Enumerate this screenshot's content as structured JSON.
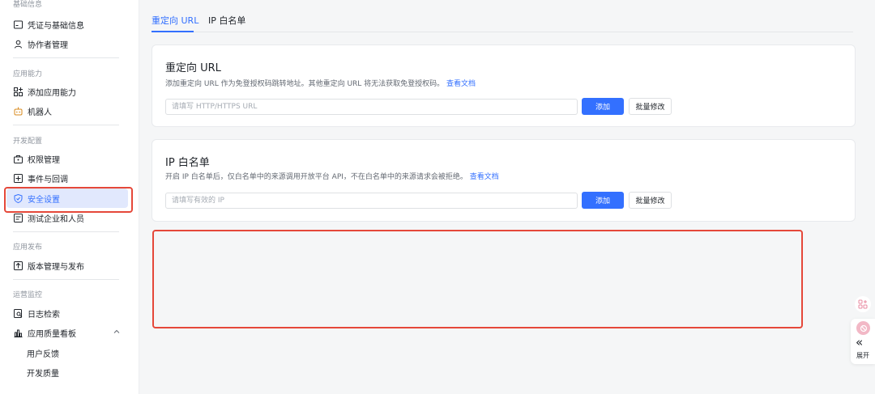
{
  "sidebar": {
    "groups": [
      {
        "title": "基础信息",
        "items": [
          {
            "label": "凭证与基础信息",
            "icon": "credential-icon"
          },
          {
            "label": "协作者管理",
            "icon": "user-icon"
          }
        ]
      },
      {
        "title": "应用能力",
        "items": [
          {
            "label": "添加应用能力",
            "icon": "apps-add-icon"
          },
          {
            "label": "机器人",
            "icon": "robot-icon"
          }
        ]
      },
      {
        "title": "开发配置",
        "items": [
          {
            "label": "权限管理",
            "icon": "permission-icon"
          },
          {
            "label": "事件与回调",
            "icon": "event-icon"
          },
          {
            "label": "安全设置",
            "icon": "shield-icon",
            "active": true
          },
          {
            "label": "测试企业和人员",
            "icon": "test-org-icon"
          }
        ]
      },
      {
        "title": "应用发布",
        "items": [
          {
            "label": "版本管理与发布",
            "icon": "upload-icon"
          }
        ]
      },
      {
        "title": "运营监控",
        "items": [
          {
            "label": "日志检索",
            "icon": "log-search-icon"
          },
          {
            "label": "应用质量看板",
            "icon": "bar-chart-icon",
            "expanded": true
          },
          {
            "label": "用户反馈",
            "sub": true
          },
          {
            "label": "开发质量",
            "sub": true
          }
        ]
      }
    ]
  },
  "tabs": [
    {
      "label": "重定向 URL",
      "active": true
    },
    {
      "label": "IP 白名单",
      "active": false
    }
  ],
  "redirect": {
    "title": "重定向 URL",
    "desc": "添加重定向 URL 作为免登授权码跳转地址。其他重定向 URL 将无法获取免登授权码。",
    "link": "查看文档",
    "placeholder": "请填写 HTTP/HTTPS URL",
    "add_label": "添加",
    "batch_label": "批量修改"
  },
  "ip": {
    "title": "IP 白名单",
    "desc": "开启 IP 白名单后，仅白名单中的来源调用开放平台 API，不在白名单中的来源请求会被拒绝。",
    "link": "查看文档",
    "placeholder": "请填写有效的 IP",
    "add_label": "添加",
    "batch_label": "批量修改"
  },
  "float": {
    "expand_label": "展开"
  },
  "colors": {
    "accent": "#3370ff",
    "highlight": "#e5483a"
  }
}
